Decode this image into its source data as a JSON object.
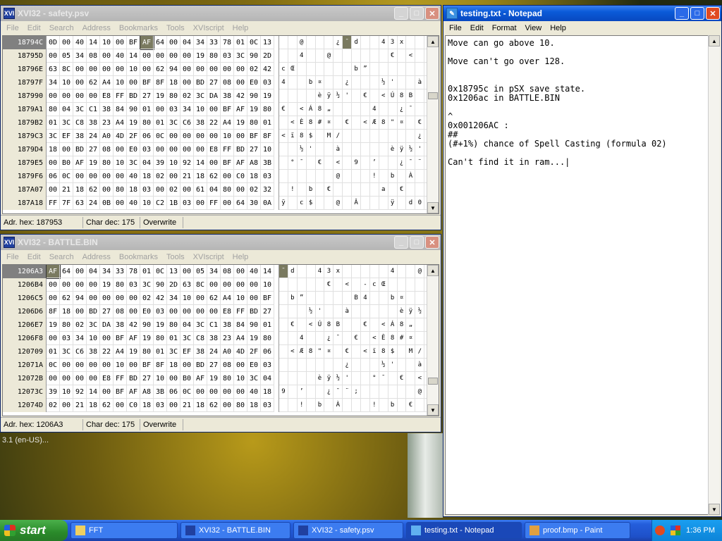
{
  "desktop": {
    "lang_text": "3.1 (en-US)..."
  },
  "hex_menu": [
    "File",
    "Edit",
    "Search",
    "Address",
    "Bookmarks",
    "Tools",
    "XVIscript",
    "Help"
  ],
  "hex1": {
    "title": "XVI32 - safety.psv",
    "rows": [
      {
        "addr": "18794C",
        "bytes": [
          "0D",
          "00",
          "40",
          "14",
          "10",
          "00",
          "BF",
          "AF",
          "64",
          "00",
          "04",
          "34",
          "33",
          "78",
          "01",
          "0C",
          "13"
        ],
        "chars": [
          "",
          "",
          "@",
          "",
          "",
          "",
          "¿",
          "¯",
          "d",
          "",
          "",
          "4",
          "3",
          "x",
          "",
          "",
          ""
        ]
      },
      {
        "addr": "18795D",
        "bytes": [
          "00",
          "05",
          "34",
          "08",
          "00",
          "40",
          "14",
          "00",
          "00",
          "00",
          "00",
          "19",
          "80",
          "03",
          "3C",
          "90",
          "2D"
        ],
        "chars": [
          "",
          "",
          "4",
          "",
          "",
          "@",
          "",
          "",
          "",
          "",
          "",
          "",
          "€",
          "",
          "<",
          "",
          ""
        ]
      },
      {
        "addr": "18796E",
        "bytes": [
          "63",
          "8C",
          "00",
          "00",
          "00",
          "00",
          "10",
          "00",
          "62",
          "94",
          "00",
          "00",
          "00",
          "00",
          "00",
          "02",
          "42"
        ],
        "chars": [
          "c",
          "Œ",
          "",
          "",
          "",
          "",
          "",
          "",
          "b",
          "”",
          "",
          "",
          "",
          "",
          "",
          "",
          "B"
        ]
      },
      {
        "addr": "18797F",
        "bytes": [
          "34",
          "10",
          "00",
          "62",
          "A4",
          "10",
          "00",
          "BF",
          "8F",
          "18",
          "00",
          "BD",
          "27",
          "08",
          "00",
          "E0",
          "03"
        ],
        "chars": [
          "4",
          "",
          "",
          "b",
          "¤",
          "",
          "",
          "¿",
          "",
          "",
          "",
          "½",
          "'",
          "",
          "",
          "à",
          ""
        ]
      },
      {
        "addr": "187990",
        "bytes": [
          "00",
          "00",
          "00",
          "00",
          "E8",
          "FF",
          "BD",
          "27",
          "19",
          "80",
          "02",
          "3C",
          "DA",
          "38",
          "42",
          "90",
          "19"
        ],
        "chars": [
          "",
          "",
          "",
          "",
          "è",
          "ÿ",
          "½",
          "'",
          "",
          "€",
          "",
          "<",
          "Ú",
          "8",
          "B",
          "",
          ""
        ]
      },
      {
        "addr": "1879A1",
        "bytes": [
          "80",
          "04",
          "3C",
          "C1",
          "38",
          "84",
          "90",
          "01",
          "00",
          "03",
          "34",
          "10",
          "00",
          "BF",
          "AF",
          "19",
          "80"
        ],
        "chars": [
          "€",
          "",
          "<",
          "Á",
          "8",
          "„",
          "",
          "",
          "",
          "",
          "4",
          "",
          "",
          "¿",
          "¯",
          "",
          "€"
        ]
      },
      {
        "addr": "1879B2",
        "bytes": [
          "01",
          "3C",
          "C8",
          "38",
          "23",
          "A4",
          "19",
          "80",
          "01",
          "3C",
          "C6",
          "38",
          "22",
          "A4",
          "19",
          "80",
          "01"
        ],
        "chars": [
          "",
          "<",
          "È",
          "8",
          "#",
          "¤",
          "",
          "€",
          "",
          "<",
          "Æ",
          "8",
          "\"",
          "¤",
          "",
          "€",
          ""
        ]
      },
      {
        "addr": "1879C3",
        "bytes": [
          "3C",
          "EF",
          "38",
          "24",
          "A0",
          "4D",
          "2F",
          "06",
          "0C",
          "00",
          "00",
          "00",
          "00",
          "10",
          "00",
          "BF",
          "8F"
        ],
        "chars": [
          "<",
          "ï",
          "8",
          "$",
          "",
          "M",
          "/",
          "",
          "",
          "",
          "",
          "",
          "",
          "",
          "",
          "¿",
          ""
        ]
      },
      {
        "addr": "1879D4",
        "bytes": [
          "18",
          "00",
          "BD",
          "27",
          "08",
          "00",
          "E0",
          "03",
          "00",
          "00",
          "00",
          "00",
          "E8",
          "FF",
          "BD",
          "27",
          "10"
        ],
        "chars": [
          "",
          "",
          "½",
          "'",
          "",
          "",
          "à",
          "",
          "",
          "",
          "",
          "",
          "è",
          "ÿ",
          "½",
          "'",
          ""
        ]
      },
      {
        "addr": "1879E5",
        "bytes": [
          "00",
          "B0",
          "AF",
          "19",
          "80",
          "10",
          "3C",
          "04",
          "39",
          "10",
          "92",
          "14",
          "00",
          "BF",
          "AF",
          "A8",
          "3B"
        ],
        "chars": [
          "",
          "°",
          "¯",
          "",
          "€",
          "",
          "<",
          "",
          "9",
          "",
          "’",
          "",
          "",
          "¿",
          "¯",
          "¨",
          ";"
        ]
      },
      {
        "addr": "1879F6",
        "bytes": [
          "06",
          "0C",
          "00",
          "00",
          "00",
          "00",
          "40",
          "18",
          "02",
          "00",
          "21",
          "18",
          "62",
          "00",
          "C0",
          "18",
          "03"
        ],
        "chars": [
          "",
          "",
          "",
          "",
          "",
          "",
          "@",
          "",
          "",
          "",
          "!",
          "",
          "b",
          "",
          "À",
          "",
          ""
        ]
      },
      {
        "addr": "187A07",
        "bytes": [
          "00",
          "21",
          "18",
          "62",
          "00",
          "80",
          "18",
          "03",
          "00",
          "02",
          "00",
          "61",
          "04",
          "80",
          "00",
          "02",
          "32"
        ],
        "chars": [
          "",
          "!",
          "",
          "b",
          "",
          "€",
          "",
          "",
          "",
          "",
          "",
          "a",
          "",
          "€",
          "",
          "",
          "2"
        ]
      },
      {
        "addr": "187A18",
        "bytes": [
          "FF",
          "7F",
          "63",
          "24",
          "0B",
          "00",
          "40",
          "10",
          "C2",
          "1B",
          "03",
          "00",
          "FF",
          "00",
          "64",
          "30",
          "0A"
        ],
        "chars": [
          "ÿ",
          "",
          "c",
          "$",
          "",
          "",
          "@",
          "",
          "Â",
          "",
          "",
          "",
          "ÿ",
          "",
          "d",
          "0",
          ""
        ]
      }
    ],
    "status": {
      "adr": "Adr. hex: 187953",
      "chr": "Char dec: 175",
      "mode": "Overwrite"
    }
  },
  "hex2": {
    "title": "XVI32 - BATTLE.BIN",
    "rows": [
      {
        "addr": "1206A3",
        "bytes": [
          "AF",
          "64",
          "00",
          "04",
          "34",
          "33",
          "78",
          "01",
          "0C",
          "13",
          "00",
          "05",
          "34",
          "08",
          "00",
          "40",
          "14"
        ],
        "chars": [
          "¯",
          "d",
          "",
          "",
          "4",
          "3",
          "x",
          "",
          "",
          "",
          "",
          "",
          "4",
          "",
          "",
          "@",
          ""
        ]
      },
      {
        "addr": "1206B4",
        "bytes": [
          "00",
          "00",
          "00",
          "00",
          "19",
          "80",
          "03",
          "3C",
          "90",
          "2D",
          "63",
          "8C",
          "00",
          "00",
          "00",
          "00",
          "10"
        ],
        "chars": [
          "",
          "",
          "",
          "",
          "",
          "€",
          "",
          "<",
          "",
          "-",
          "c",
          "Œ",
          "",
          "",
          "",
          "",
          ""
        ]
      },
      {
        "addr": "1206C5",
        "bytes": [
          "00",
          "62",
          "94",
          "00",
          "00",
          "00",
          "00",
          "02",
          "42",
          "34",
          "10",
          "00",
          "62",
          "A4",
          "10",
          "00",
          "BF"
        ],
        "chars": [
          "",
          "b",
          "”",
          "",
          "",
          "",
          "",
          "",
          "B",
          "4",
          "",
          "",
          "b",
          "¤",
          "",
          "",
          "¿"
        ]
      },
      {
        "addr": "1206D6",
        "bytes": [
          "8F",
          "18",
          "00",
          "BD",
          "27",
          "08",
          "00",
          "E0",
          "03",
          "00",
          "00",
          "00",
          "00",
          "E8",
          "FF",
          "BD",
          "27"
        ],
        "chars": [
          "",
          "",
          "",
          "½",
          "'",
          "",
          "",
          "à",
          "",
          "",
          "",
          "",
          "",
          "è",
          "ÿ",
          "½",
          "'"
        ]
      },
      {
        "addr": "1206E7",
        "bytes": [
          "19",
          "80",
          "02",
          "3C",
          "DA",
          "38",
          "42",
          "90",
          "19",
          "80",
          "04",
          "3C",
          "C1",
          "38",
          "84",
          "90",
          "01"
        ],
        "chars": [
          "",
          "€",
          "",
          "<",
          "Ú",
          "8",
          "B",
          "",
          "",
          "€",
          "",
          "<",
          "Á",
          "8",
          "„",
          "",
          ""
        ]
      },
      {
        "addr": "1206F8",
        "bytes": [
          "00",
          "03",
          "34",
          "10",
          "00",
          "BF",
          "AF",
          "19",
          "80",
          "01",
          "3C",
          "C8",
          "38",
          "23",
          "A4",
          "19",
          "80"
        ],
        "chars": [
          "",
          "",
          "4",
          "",
          "",
          "¿",
          "¯",
          "",
          "€",
          "",
          "<",
          "È",
          "8",
          "#",
          "¤",
          "",
          "€"
        ]
      },
      {
        "addr": "120709",
        "bytes": [
          "01",
          "3C",
          "C6",
          "38",
          "22",
          "A4",
          "19",
          "80",
          "01",
          "3C",
          "EF",
          "38",
          "24",
          "A0",
          "4D",
          "2F",
          "06"
        ],
        "chars": [
          "",
          "<",
          "Æ",
          "8",
          "\"",
          "¤",
          "",
          "€",
          "",
          "<",
          "ï",
          "8",
          "$",
          "",
          "M",
          "/",
          ""
        ]
      },
      {
        "addr": "12071A",
        "bytes": [
          "0C",
          "00",
          "00",
          "00",
          "00",
          "10",
          "00",
          "BF",
          "8F",
          "18",
          "00",
          "BD",
          "27",
          "08",
          "00",
          "E0",
          "03"
        ],
        "chars": [
          "",
          "",
          "",
          "",
          "",
          "",
          "",
          "¿",
          "",
          "",
          "",
          "½",
          "'",
          "",
          "",
          "à",
          ""
        ]
      },
      {
        "addr": "12072B",
        "bytes": [
          "00",
          "00",
          "00",
          "00",
          "E8",
          "FF",
          "BD",
          "27",
          "10",
          "00",
          "B0",
          "AF",
          "19",
          "80",
          "10",
          "3C",
          "04"
        ],
        "chars": [
          "",
          "",
          "",
          "",
          "è",
          "ÿ",
          "½",
          "'",
          "",
          "",
          "°",
          "¯",
          "",
          "€",
          "",
          "<",
          ""
        ]
      },
      {
        "addr": "12073C",
        "bytes": [
          "39",
          "10",
          "92",
          "14",
          "00",
          "BF",
          "AF",
          "A8",
          "3B",
          "06",
          "0C",
          "00",
          "00",
          "00",
          "00",
          "40",
          "18"
        ],
        "chars": [
          "9",
          "",
          "’",
          "",
          "",
          "¿",
          "¯",
          "¨",
          ";",
          "",
          "",
          "",
          "",
          "",
          "",
          "@",
          ""
        ]
      },
      {
        "addr": "12074D",
        "bytes": [
          "02",
          "00",
          "21",
          "18",
          "62",
          "00",
          "C0",
          "18",
          "03",
          "00",
          "21",
          "18",
          "62",
          "00",
          "80",
          "18",
          "03"
        ],
        "chars": [
          "",
          "",
          "!",
          "",
          "b",
          "",
          "À",
          "",
          "",
          "",
          "!",
          "",
          "b",
          "",
          "€",
          "",
          ""
        ]
      }
    ],
    "status": {
      "adr": "Adr. hex: 1206A3",
      "chr": "Char dec: 175",
      "mode": "Overwrite"
    }
  },
  "notepad": {
    "title": "testing.txt - Notepad",
    "menu": [
      "File",
      "Edit",
      "Format",
      "View",
      "Help"
    ],
    "lines": [
      "Move can go above 10.",
      "",
      "Move can't go over 128.",
      "",
      "",
      "0x18795c in pSX save state.",
      "0x1206ac in BATTLE.BIN",
      "",
      "^",
      "0x001206AC :",
      "##",
      "(#+1%) chance of Spell Casting (formula 02)",
      "",
      "Can't find it in ram...|"
    ]
  },
  "taskbar": {
    "start_label": "start",
    "buttons": [
      {
        "label": "FFT",
        "icon": "folder-icon"
      },
      {
        "label": "XVI32 - BATTLE.BIN",
        "icon": "xvi32-icon"
      },
      {
        "label": "XVI32 - safety.psv",
        "icon": "xvi32-icon"
      },
      {
        "label": "testing.txt - Notepad",
        "icon": "notepad-icon"
      },
      {
        "label": "proof.bmp - Paint",
        "icon": "paint-icon"
      }
    ],
    "clock": "1:36 PM"
  }
}
